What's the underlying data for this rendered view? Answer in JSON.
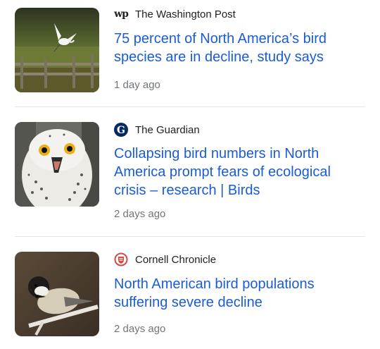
{
  "articles": [
    {
      "source": "The Washington Post",
      "source_icon": "washington-post-logo-icon",
      "headline": "75 percent of North America’s bird species are in decline, study says",
      "time": "1 day ago",
      "thumbnail": "egret-flying-over-fence"
    },
    {
      "source": "The Guardian",
      "source_icon": "guardian-logo-icon",
      "headline": "Collapsing bird numbers in North America prompt fears of ecological crisis – research | Birds",
      "time": "2 days ago",
      "thumbnail": "snowy-owl"
    },
    {
      "source": "Cornell Chronicle",
      "source_icon": "cornell-chronicle-logo-icon",
      "headline": "North American bird populations suffering severe decline",
      "time": "2 days ago",
      "thumbnail": "chickadee-on-branch"
    }
  ],
  "colors": {
    "headline": "#1a5cd6",
    "source_text": "#202124",
    "time_text": "#70757a",
    "divider": "#e4e4e4",
    "cornell_red": "#d24b43"
  }
}
